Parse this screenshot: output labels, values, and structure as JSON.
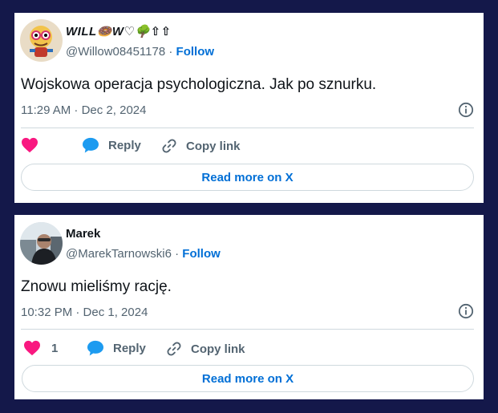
{
  "tweets": [
    {
      "display_name": "WILL🍩W♡🌳⇧⇧",
      "handle": "@Willow08451178",
      "separator": "·",
      "follow_label": "Follow",
      "text": "Wojskowa operacja psychologiczna. Jak po sznurku.",
      "timestamp": "11:29 AM · Dec 2, 2024",
      "like_count": "",
      "reply_label": "Reply",
      "copy_link_label": "Copy link",
      "read_more_label": "Read more on X"
    },
    {
      "display_name": "Marek",
      "handle": "@MarekTarnowski6",
      "separator": "·",
      "follow_label": "Follow",
      "text": "Znowu mieliśmy rację.",
      "timestamp": "10:32 PM · Dec 1, 2024",
      "like_count": "1",
      "reply_label": "Reply",
      "copy_link_label": "Copy link",
      "read_more_label": "Read more on X"
    }
  ],
  "colors": {
    "background": "#14184a",
    "card": "#ffffff",
    "link": "#006fd6",
    "muted": "#536471",
    "heart": "#f91880",
    "reply_bubble": "#1d9bf0"
  },
  "icons": [
    "heart-icon",
    "reply-bubble-icon",
    "link-icon",
    "info-icon"
  ]
}
